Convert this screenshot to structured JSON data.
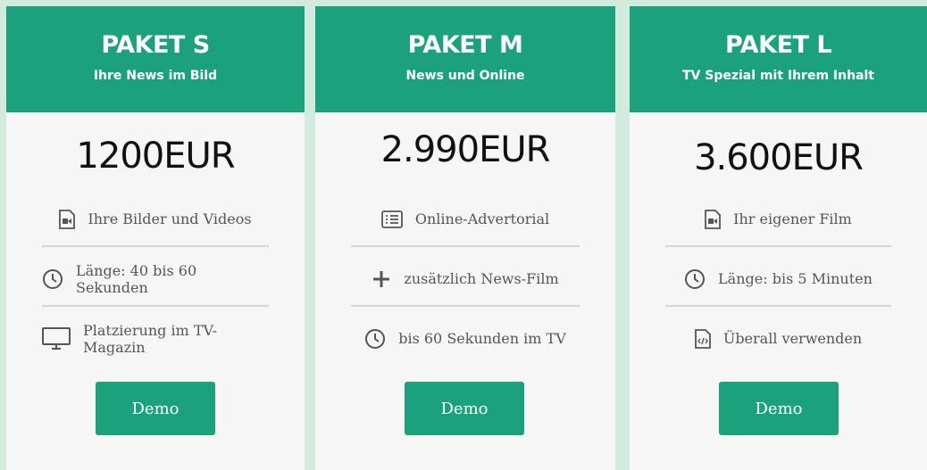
{
  "colors": {
    "accent": "#1ba27c",
    "background": "#d3ebdf",
    "card": "#f6f6f6"
  },
  "packages": [
    {
      "title": "PAKET S",
      "subtitle": "Ihre News im Bild",
      "price": "1200EUR",
      "features": [
        {
          "icon": "video-file-icon",
          "text": "Ihre Bilder und Videos"
        },
        {
          "icon": "clock-icon",
          "text": "Länge: 40 bis 60 Sekunden"
        },
        {
          "icon": "monitor-icon",
          "text": "Platzierung im TV-Magazin"
        }
      ],
      "button_label": "Demo"
    },
    {
      "title": "PAKET M",
      "subtitle": "News und Online",
      "price": "2.990EUR",
      "features": [
        {
          "icon": "list-icon",
          "text": "Online-Advertorial"
        },
        {
          "icon": "plus-icon",
          "text": "zusätzlich News-Film"
        },
        {
          "icon": "clock-icon",
          "text": "bis 60 Sekunden im TV"
        }
      ],
      "button_label": "Demo"
    },
    {
      "title": "PAKET L",
      "subtitle": "TV Spezial mit Ihrem Inhalt",
      "price": "3.600EUR",
      "features": [
        {
          "icon": "video-file-icon",
          "text": "Ihr eigener Film"
        },
        {
          "icon": "clock-icon",
          "text": "Länge: bis 5 Minuten"
        },
        {
          "icon": "code-file-icon",
          "text": "Überall verwenden"
        }
      ],
      "button_label": "Demo"
    }
  ]
}
